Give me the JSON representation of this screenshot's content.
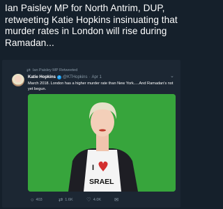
{
  "headline": "Ian Paisley MP for North Antrim, DUP, retweeting Katie Hopkins insinuating that murder rates in London will rise during Ramadan...",
  "tweet": {
    "retweet_label": "Ian Paisley MP Retweeted",
    "author_name": "Katie Hopkins",
    "handle": "@KTHopkins",
    "separator": "·",
    "date": "Apr 1",
    "text": "March 2018. London has a higher  murder rate than New York.....And Ramadan's not yet begun.",
    "shirt_text": "I",
    "shirt_text2": "SRAEL",
    "replies": "403",
    "retweets": "1.6K",
    "likes": "4.0K"
  },
  "icons": {
    "retweet": "retweet-icon",
    "verified": "verified-badge-icon",
    "chevron": "chevron-down-icon",
    "reply": "reply-icon",
    "like": "heart-icon",
    "message": "direct-message-icon"
  },
  "colors": {
    "background": "#15202b",
    "card": "#1c2733",
    "muted": "#8899a6",
    "accent": "#1da1f2",
    "photo_bg": "#3aa83f"
  }
}
